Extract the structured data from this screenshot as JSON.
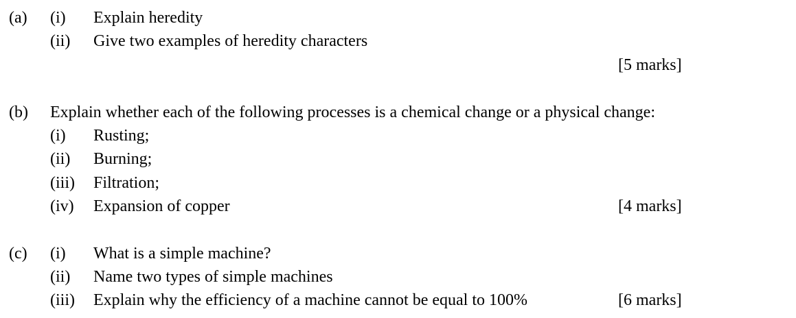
{
  "questions": [
    {
      "part": "(a)",
      "stem": "",
      "items": [
        {
          "num": "(i)",
          "text": "Explain heredity"
        },
        {
          "num": "(ii)",
          "text": "Give two examples of heredity characters"
        }
      ],
      "marks": "[5 marks]"
    },
    {
      "part": "(b)",
      "stem": "Explain whether each of the following processes is a chemical change or a physical change:",
      "items": [
        {
          "num": "(i)",
          "text": "Rusting;"
        },
        {
          "num": "(ii)",
          "text": "Burning;"
        },
        {
          "num": "(iii)",
          "text": "Filtration;"
        },
        {
          "num": "(iv)",
          "text": "Expansion of copper"
        }
      ],
      "marks": "[4 marks]"
    },
    {
      "part": "(c)",
      "stem": "",
      "items": [
        {
          "num": "(i)",
          "text": "What is a simple machine?"
        },
        {
          "num": "(ii)",
          "text": "Name two types of simple machines"
        },
        {
          "num": "(iii)",
          "text": "Explain why the efficiency of a machine cannot be equal to 100%"
        }
      ],
      "marks": "[6 marks]"
    }
  ]
}
